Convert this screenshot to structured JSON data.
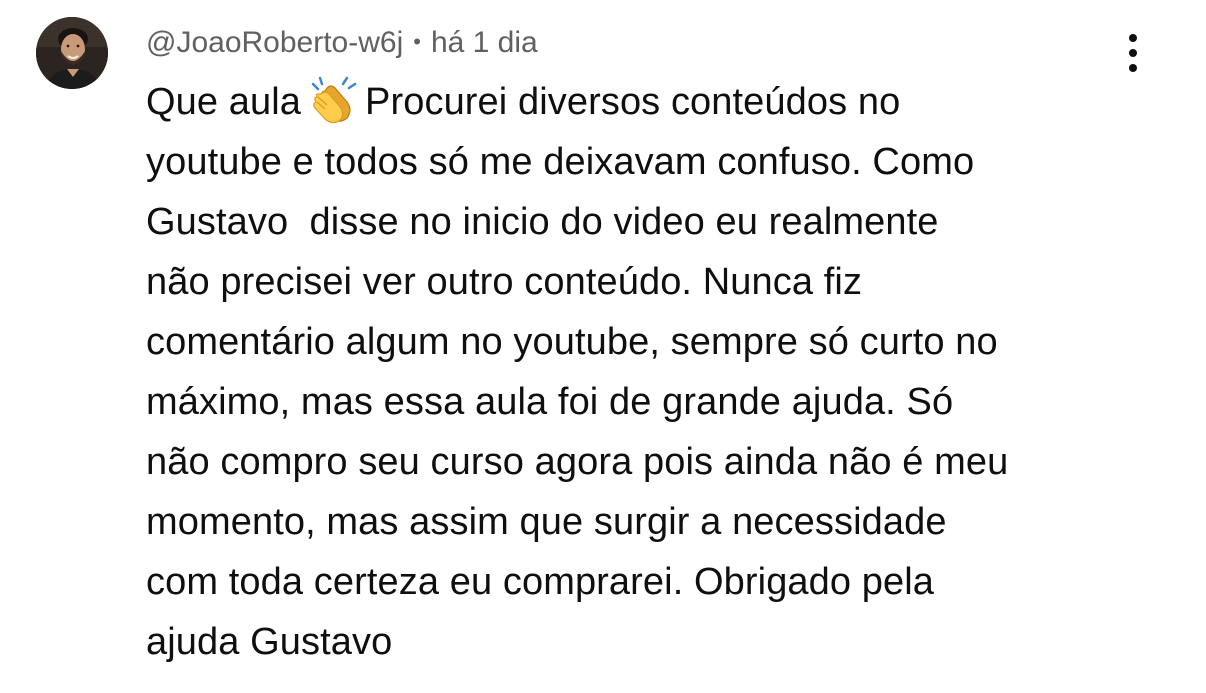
{
  "comment": {
    "author": "@JoaoRoberto-w6j",
    "separator": "•",
    "timestamp": "há 1 dia",
    "emoji": "clapping-hands",
    "first_line_before_emoji": "Que aula",
    "first_line_after_emoji": "Procurei diversos conteúdos no",
    "lines": [
      "youtube e todos só me deixavam confuso. Como",
      "Gustavo  disse no inicio do video eu realmente",
      "não precisei ver outro conteúdo. Nunca fiz",
      "comentário algum no youtube, sempre só curto no",
      "máximo, mas essa aula foi de grande ajuda. Só",
      "não compro seu curso agora pois ainda não é meu",
      "momento, mas assim que surgir a necessidade",
      "com toda certeza eu comprarei. Obrigado pela",
      "ajuda Gustavo"
    ]
  },
  "colors": {
    "text": "#0f0f0f",
    "meta_text": "#606060",
    "background": "#ffffff"
  },
  "icons": {
    "menu": "more-vert-icon",
    "avatar": "user-avatar"
  }
}
